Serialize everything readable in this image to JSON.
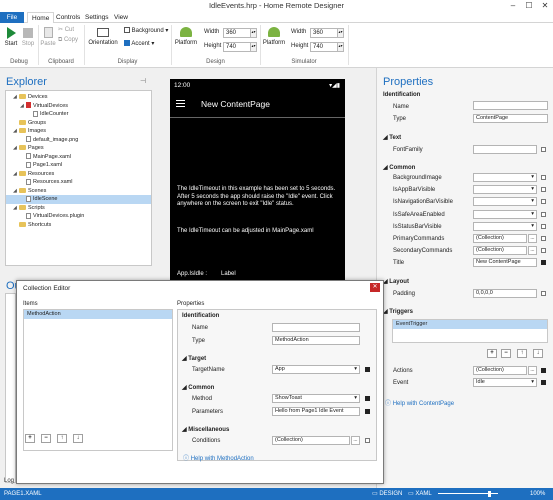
{
  "window": {
    "title": "IdleEvents.hrp - Home Remote Designer",
    "minimize": "–",
    "maximize": "☐",
    "close": "✕"
  },
  "tabs": [
    "File",
    "Home",
    "Controls",
    "Settings",
    "View"
  ],
  "ribbon": {
    "start": "Start",
    "stop": "Stop",
    "paste": "Paste",
    "cut": "Cut",
    "copy": "Copy",
    "orientation": "Orientation",
    "background": "Background",
    "accent": "Accent",
    "platform": "Platform",
    "width_label": "Width",
    "height_label": "Height",
    "design_width": "360",
    "design_height": "740",
    "sim_width": "360",
    "sim_height": "740",
    "groups": {
      "debug": "Debug",
      "clipboard": "Clipboard",
      "display": "Display",
      "design": "Design",
      "simulator": "Simulator"
    }
  },
  "explorer": {
    "title": "Explorer",
    "items": [
      {
        "label": "Devices",
        "kind": "folder",
        "indent": 1,
        "arrow": "◢"
      },
      {
        "label": "VirtualDevices",
        "kind": "red",
        "indent": 2,
        "arrow": "◢"
      },
      {
        "label": "IdleCounter",
        "kind": "file",
        "indent": 3,
        "arrow": ""
      },
      {
        "label": "Groups",
        "kind": "folder",
        "indent": 1,
        "arrow": ""
      },
      {
        "label": "Images",
        "kind": "folder",
        "indent": 1,
        "arrow": "◢"
      },
      {
        "label": "default_image.png",
        "kind": "file",
        "indent": 2,
        "arrow": ""
      },
      {
        "label": "Pages",
        "kind": "folder",
        "indent": 1,
        "arrow": "◢"
      },
      {
        "label": "MainPage.xaml",
        "kind": "file",
        "indent": 2,
        "arrow": ""
      },
      {
        "label": "Page1.xaml",
        "kind": "file",
        "indent": 2,
        "arrow": ""
      },
      {
        "label": "Resources",
        "kind": "folder",
        "indent": 1,
        "arrow": "◢"
      },
      {
        "label": "Resources.xaml",
        "kind": "file",
        "indent": 2,
        "arrow": ""
      },
      {
        "label": "Scenes",
        "kind": "folder",
        "indent": 1,
        "arrow": "◢"
      },
      {
        "label": "IdleScene",
        "kind": "file",
        "indent": 2,
        "arrow": "",
        "selected": true
      },
      {
        "label": "Scripts",
        "kind": "folder",
        "indent": 1,
        "arrow": "◢"
      },
      {
        "label": "VirtualDevices.plugin",
        "kind": "file",
        "indent": 2,
        "arrow": ""
      },
      {
        "label": "Shortcuts",
        "kind": "folder",
        "indent": 1,
        "arrow": ""
      }
    ]
  },
  "outline_title": "Ou",
  "phone": {
    "time": "12:00",
    "header": "New ContentPage",
    "para1": "The IdleTimeout in this example has been set to 5 seconds. After 5 seconds the app should raise the \"Idle\" event. Click anywhere on the screen to exit \"Idle\" status.",
    "para2": "The IdleTimeout can be adjusted in MainPage.xaml",
    "app_label": "App.IsIdle :",
    "label": "Label"
  },
  "properties": {
    "title": "Properties",
    "identification": "Identification",
    "name_label": "Name",
    "name_value": "",
    "type_label": "Type",
    "type_value": "ContentPage",
    "text_section": "Text",
    "fontfamily_label": "FontFamily",
    "common_section": "Common",
    "common_rows": [
      {
        "label": "BackgroundImage",
        "value": "",
        "kind": "select"
      },
      {
        "label": "IsAppBarVisible",
        "value": "",
        "kind": "select"
      },
      {
        "label": "IsNavigationBarVisible",
        "value": "",
        "kind": "select"
      },
      {
        "label": "IsSafeAreaEnabled",
        "value": "",
        "kind": "select"
      },
      {
        "label": "IsStatusBarVisible",
        "value": "",
        "kind": "select"
      },
      {
        "label": "PrimaryCommands",
        "value": "(Collection)",
        "kind": "dots"
      },
      {
        "label": "SecondaryCommands",
        "value": "(Collection)",
        "kind": "dots"
      },
      {
        "label": "Title",
        "value": "New ContentPage",
        "kind": "text"
      }
    ],
    "layout_section": "Layout",
    "padding_label": "Padding",
    "padding_value": "0,0,0,0",
    "triggers_section": "Triggers",
    "trigger_item": "EventTrigger",
    "actions_label": "Actions",
    "actions_value": "(Collection)",
    "event_label": "Event",
    "event_value": "Idle",
    "help": "Help with ContentPage"
  },
  "dialog": {
    "title": "Collection Editor",
    "items_label": "Items",
    "properties_label": "Properties",
    "list_item": "MethodAction",
    "identification": "Identification",
    "name_label": "Name",
    "name_value": "",
    "type_label": "Type",
    "type_value": "MethodAction",
    "target_section": "Target",
    "targetname_label": "TargetName",
    "targetname_value": "App",
    "common_section": "Common",
    "method_label": "Method",
    "method_value": "ShowToast",
    "parameters_label": "Parameters",
    "parameters_value": "Hello from Page1 Idle Event",
    "misc_section": "Miscellaneous",
    "conditions_label": "Conditions",
    "conditions_value": "(Collection)",
    "help": "Help with MethodAction",
    "add": "+",
    "remove": "−",
    "up": "↑",
    "down": "↓"
  },
  "log_label": "Log",
  "status": {
    "file": "PAGE1.XAML",
    "design": "DESIGN",
    "xaml": "XAML",
    "zoom": "100%"
  },
  "colors": {
    "accent": "#1e6fc0",
    "phone_header": "#000000"
  }
}
